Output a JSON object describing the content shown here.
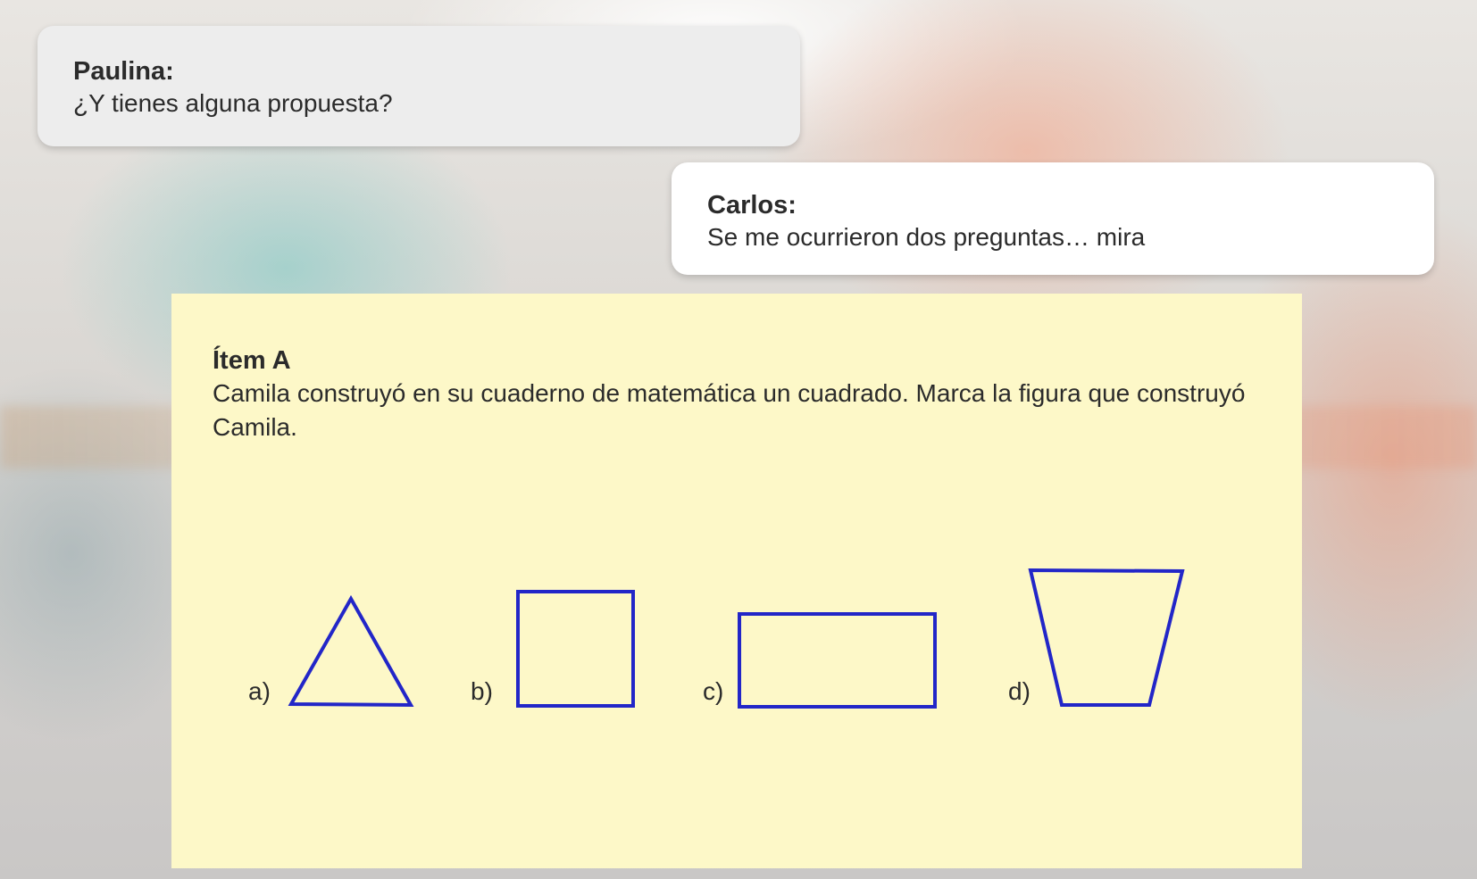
{
  "dialogue": [
    {
      "speaker": "Paulina:",
      "message": "¿Y tienes alguna propuesta?"
    },
    {
      "speaker": "Carlos:",
      "message": "Se me ocurrieron dos preguntas… mira"
    }
  ],
  "item": {
    "title": "Ítem A",
    "text": "Camila construyó en su cuaderno de matemática un cuadrado. Marca la figura que construyó Camila.",
    "shape_color": "#2226c8",
    "options": [
      {
        "label": "a)",
        "shape": "triangle-icon"
      },
      {
        "label": "b)",
        "shape": "square-icon"
      },
      {
        "label": "c)",
        "shape": "rectangle-icon"
      },
      {
        "label": "d)",
        "shape": "trapezoid-icon"
      }
    ]
  }
}
